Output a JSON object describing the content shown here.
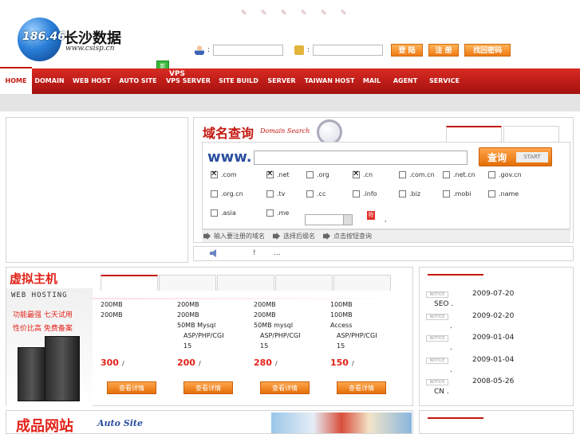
{
  "logo": {
    "number": "186.46",
    "name": "长沙数据",
    "url": "www.csisp.cn"
  },
  "login": {
    "colon1": ":",
    "colon2": ":",
    "login_label": "登 陆",
    "register_label": "注 册",
    "forgot_label": "找回密码"
  },
  "nav": {
    "vps_badge": "新",
    "vps_top": "VPS",
    "items": [
      "HOME",
      "DOMAIN",
      "WEB HOST",
      "AUTO SITE",
      "VPS SERVER",
      "SITE BUILD",
      "SERVER",
      "TAIWAN HOST",
      "MAIL",
      "AGENT",
      "SERVICE"
    ]
  },
  "domain_search": {
    "title": "域名查询",
    "title_en": "Domain Search",
    "www": "www.",
    "search_label": "查询",
    "search_en": "START",
    "tlds": [
      {
        "label": ".com",
        "checked": true
      },
      {
        "label": ".net",
        "checked": true
      },
      {
        "label": ".org",
        "checked": false
      },
      {
        "label": ".cn",
        "checked": true
      },
      {
        "label": ".com.cn",
        "checked": false
      },
      {
        "label": ".net.cn",
        "checked": false
      },
      {
        "label": ".gov.cn",
        "checked": false
      },
      {
        "label": ".org.cn",
        "checked": false
      },
      {
        "label": ".tv",
        "checked": false
      },
      {
        "label": ".cc",
        "checked": false
      },
      {
        "label": ".info",
        "checked": false
      },
      {
        "label": ".biz",
        "checked": false
      },
      {
        "label": ".mobi",
        "checked": false
      },
      {
        "label": ".name",
        "checked": false
      },
      {
        "label": ".asia",
        "checked": false
      },
      {
        "label": ".me",
        "checked": false
      }
    ],
    "red_icon": "符",
    "red_dot": ",",
    "steps": [
      "输入要注册的域名",
      "选择后缀名",
      "点击按钮查询"
    ]
  },
  "notice_bar": {
    "excl": "!",
    "dots": "..."
  },
  "hosting": {
    "title": "虚拟主机",
    "side_title": "WEB HOSTING",
    "slogan1": "功能最强 七天试用",
    "slogan2": "性价比高 免费备案",
    "plans": [
      {
        "lines": [
          "200MB",
          "200MB",
          "",
          "",
          ""
        ],
        "price": "300",
        "unit": "/",
        "button": "查看详情"
      },
      {
        "lines": [
          "200MB",
          "200MB",
          "50MB Mysql",
          "ASP/PHP/CGI",
          "15"
        ],
        "price": "200",
        "unit": "/",
        "button": "查看详情"
      },
      {
        "lines": [
          "200MB",
          "200MB",
          "50MB mysql",
          "ASP/PHP/CGI",
          "15"
        ],
        "price": "280",
        "unit": "/",
        "button": "查看详情"
      },
      {
        "lines": [
          "100MB",
          "100MB",
          "Access",
          "ASP/PHP/CGI",
          "15"
        ],
        "price": "150",
        "unit": "/",
        "button": "查看详情"
      }
    ]
  },
  "news": {
    "tag": "NOTICE",
    "items": [
      {
        "date": "2009-07-20",
        "sub": "SEO   ."
      },
      {
        "date": "2009-02-20",
        "sub": "."
      },
      {
        "date": "2009-01-04",
        "sub": "."
      },
      {
        "date": "2009-01-04",
        "sub": "."
      },
      {
        "date": "2008-05-26",
        "sub": "CN     ."
      }
    ]
  },
  "auto_site": {
    "title": "成品网站",
    "title_en": "Auto Site"
  }
}
